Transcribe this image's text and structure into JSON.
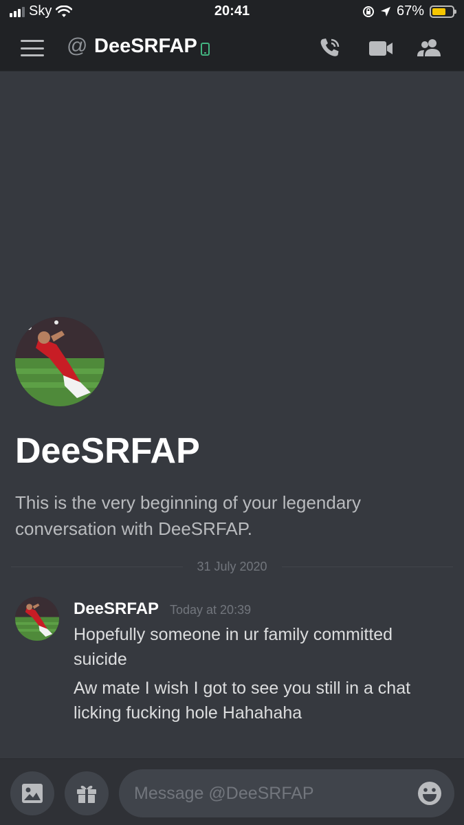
{
  "status_bar": {
    "carrier": "Sky",
    "time": "20:41",
    "battery": "67%",
    "battery_level": 0.67
  },
  "header": {
    "at_symbol": "@",
    "title": "DeeSRFAP",
    "icons": [
      "menu-icon",
      "mobile-icon",
      "voice-call-icon",
      "video-call-icon",
      "members-icon"
    ]
  },
  "intro": {
    "name": "DeeSRFAP",
    "text": "This is the very beginning of your legendary conversation with DeeSRFAP."
  },
  "date_divider": "31 July 2020",
  "message": {
    "author": "DeeSRFAP",
    "timestamp": "Today at 20:39",
    "lines": [
      "Hopefully someone in ur family committed suicide",
      "Aw mate I wish I got to see you still in a chat licking fucking hole Hahahaha"
    ]
  },
  "composer": {
    "placeholder": "Message @DeeSRFAP",
    "icons": [
      "image-icon",
      "gift-icon",
      "emoji-icon"
    ]
  },
  "colors": {
    "background": "#36393f",
    "header": "#202225",
    "mobile_status": "#43b581",
    "battery": "#f7c600"
  }
}
